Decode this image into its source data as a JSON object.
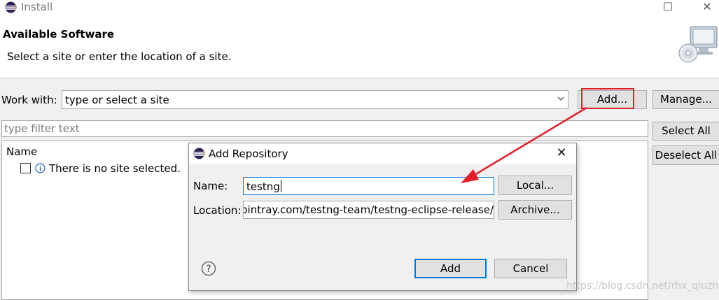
{
  "window": {
    "title": "Install",
    "maximize_glyph": "☐",
    "close_glyph": "✕"
  },
  "header": {
    "title": "Available Software",
    "description": "Select a site or enter the location of a site."
  },
  "work_with": {
    "label": "Work with:",
    "value": "type or select a site",
    "add_label": "Add...",
    "manage_label": "Manage..."
  },
  "filter": {
    "placeholder": "type filter text"
  },
  "buttons": {
    "select_all": "Select All",
    "deselect_all": "Deselect All"
  },
  "tree": {
    "column": "Name",
    "message": "There is no site selected."
  },
  "dialog": {
    "title": "Add Repository",
    "close_glyph": "✕",
    "name_label": "Name:",
    "name_value": "testng",
    "location_label": "Location:",
    "location_value": "bintray.com/testng-team/testng-eclipse-release/",
    "local_label": "Local...",
    "archive_label": "Archive...",
    "help_glyph": "?",
    "add_label": "Add",
    "cancel_label": "Cancel"
  },
  "annotation": {
    "highlight_color": "#e0202a"
  },
  "watermark": "https://blog.csdn.net/rhx_qiuzhi"
}
